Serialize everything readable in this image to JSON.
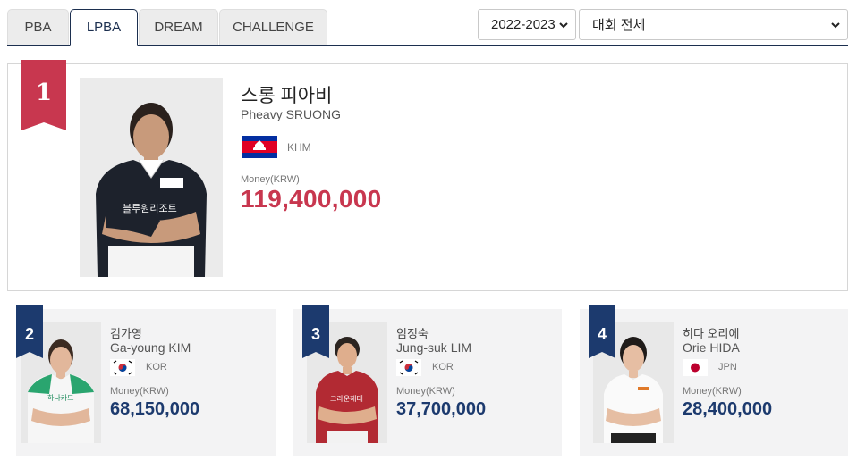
{
  "tabs": [
    {
      "label": "PBA",
      "active": false
    },
    {
      "label": "LPBA",
      "active": true
    },
    {
      "label": "DREAM",
      "active": false
    },
    {
      "label": "CHALLENGE",
      "active": false
    }
  ],
  "filters": {
    "season": "2022-2023",
    "tournament": "대회 전체"
  },
  "colors": {
    "accent_red": "#c8374f",
    "accent_navy": "#1c3a6e"
  },
  "rankings": [
    {
      "rank": "1",
      "name_ko": "스롱 피아비",
      "name_en": "Pheavy SRUONG",
      "country": "KHM",
      "flag_icon": "cambodia-flag-icon",
      "money_label": "Money(KRW)",
      "money": "119,400,000",
      "shirt_text": "블루원리조트"
    },
    {
      "rank": "2",
      "name_ko": "김가영",
      "name_en": "Ga-young KIM",
      "country": "KOR",
      "flag_icon": "korea-flag-icon",
      "money_label": "Money(KRW)",
      "money": "68,150,000",
      "shirt_text": "하나카드"
    },
    {
      "rank": "3",
      "name_ko": "임정숙",
      "name_en": "Jung-suk LIM",
      "country": "KOR",
      "flag_icon": "korea-flag-icon",
      "money_label": "Money(KRW)",
      "money": "37,700,000",
      "shirt_text": "크라운해태"
    },
    {
      "rank": "4",
      "name_ko": "히다 오리에",
      "name_en": "Orie HIDA",
      "country": "JPN",
      "flag_icon": "japan-flag-icon",
      "money_label": "Money(KRW)",
      "money": "28,400,000",
      "shirt_text": ""
    }
  ]
}
